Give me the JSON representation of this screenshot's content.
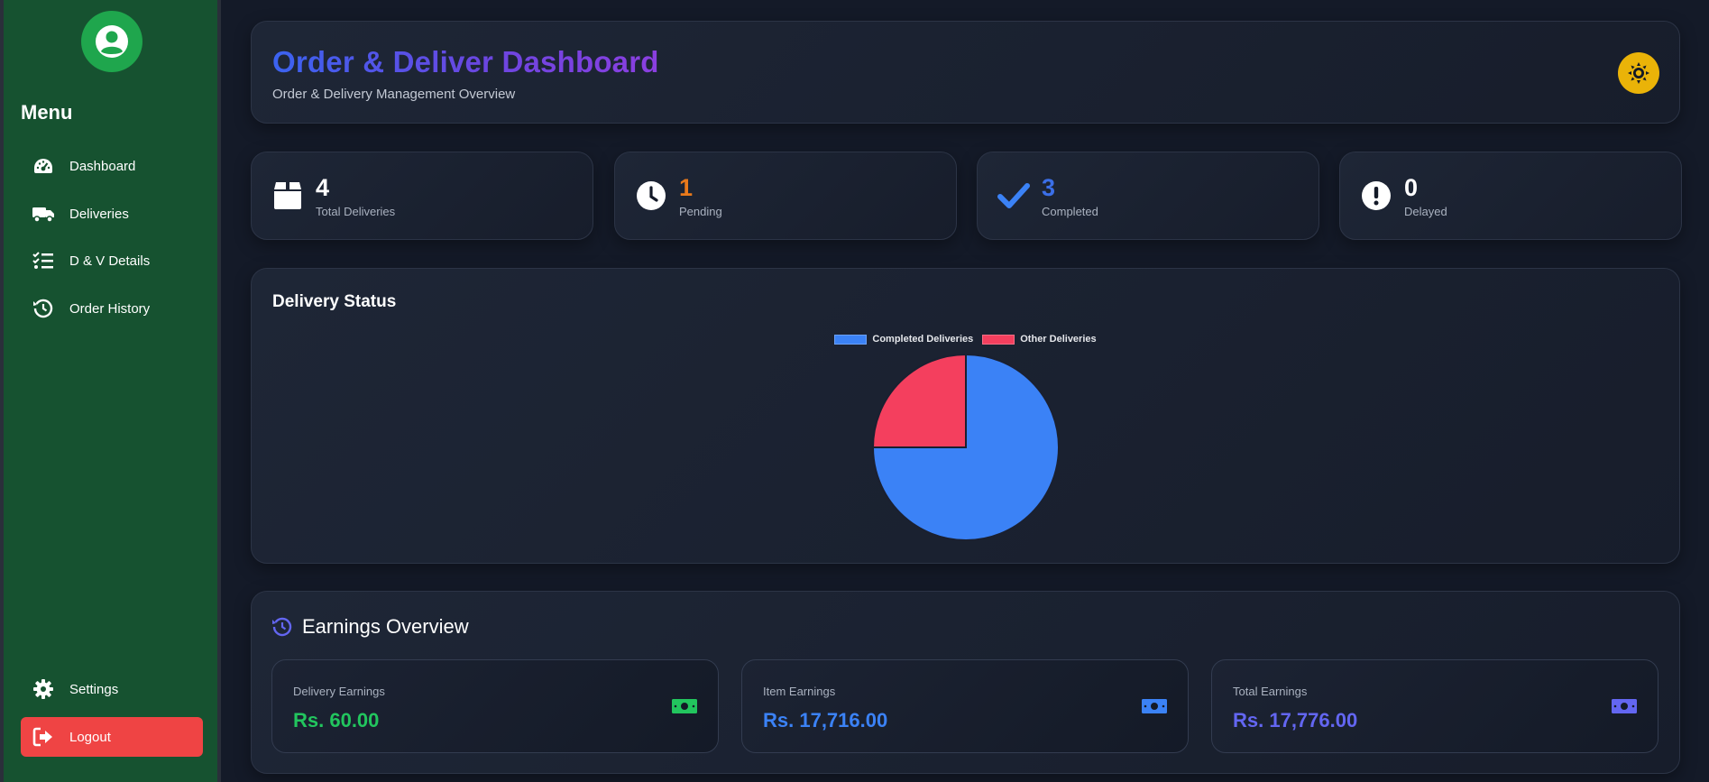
{
  "sidebar": {
    "menu_title": "Menu",
    "items": [
      {
        "label": "Dashboard",
        "icon": "gauge-icon"
      },
      {
        "label": "Deliveries",
        "icon": "truck-icon"
      },
      {
        "label": "D & V Details",
        "icon": "list-check-icon"
      },
      {
        "label": "Order History",
        "icon": "history-icon"
      }
    ],
    "settings_label": "Settings",
    "logout_label": "Logout"
  },
  "header": {
    "title": "Order & Deliver Dashboard",
    "subtitle": "Order & Delivery Management Overview"
  },
  "stats": [
    {
      "value": "4",
      "label": "Total Deliveries",
      "icon": "box-icon",
      "color": "#ffffff"
    },
    {
      "value": "1",
      "label": "Pending",
      "icon": "clock-icon",
      "color": "#ea7a1b"
    },
    {
      "value": "3",
      "label": "Completed",
      "icon": "check-icon",
      "color": "#3b6fe8"
    },
    {
      "value": "0",
      "label": "Delayed",
      "icon": "exclamation-icon",
      "color": "#ffffff"
    }
  ],
  "delivery_status": {
    "title": "Delivery Status"
  },
  "chart_data": {
    "type": "pie",
    "categories": [
      "Completed Deliveries",
      "Other Deliveries"
    ],
    "values": [
      3,
      1
    ],
    "colors": [
      "#3b82f6",
      "#f43f5e"
    ],
    "legend": "top"
  },
  "earnings": {
    "title": "Earnings Overview",
    "items": [
      {
        "label": "Delivery Earnings",
        "value": "Rs. 60.00",
        "color": "#22c55e"
      },
      {
        "label": "Item Earnings",
        "value": "Rs. 17,716.00",
        "color": "#3b82f6"
      },
      {
        "label": "Total Earnings",
        "value": "Rs. 17,776.00",
        "color": "#6366f1"
      }
    ]
  }
}
